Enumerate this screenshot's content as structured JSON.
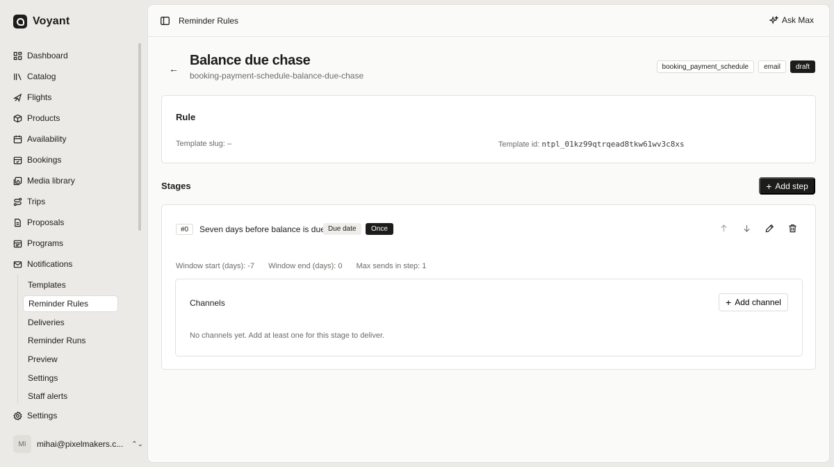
{
  "app": {
    "name": "Voyant"
  },
  "sidebar": {
    "items": [
      {
        "label": "Dashboard",
        "icon": "dashboard-icon"
      },
      {
        "label": "Catalog",
        "icon": "library-icon"
      },
      {
        "label": "Flights",
        "icon": "plane-icon"
      },
      {
        "label": "Products",
        "icon": "box-icon"
      },
      {
        "label": "Availability",
        "icon": "calendar-icon"
      },
      {
        "label": "Bookings",
        "icon": "calendar-check-icon"
      },
      {
        "label": "Media library",
        "icon": "image-icon"
      },
      {
        "label": "Trips",
        "icon": "route-icon"
      },
      {
        "label": "Proposals",
        "icon": "file-icon"
      },
      {
        "label": "Programs",
        "icon": "calendar-range-icon"
      },
      {
        "label": "Notifications",
        "icon": "mail-icon"
      }
    ],
    "sub_items": [
      {
        "label": "Templates"
      },
      {
        "label": "Reminder Rules",
        "active": true
      },
      {
        "label": "Deliveries"
      },
      {
        "label": "Reminder Runs"
      },
      {
        "label": "Preview"
      },
      {
        "label": "Settings"
      },
      {
        "label": "Staff alerts"
      }
    ],
    "settings_label": "Settings",
    "user": {
      "initials": "MI",
      "email": "mihai@pixelmakers.c..."
    }
  },
  "topbar": {
    "breadcrumb": "Reminder Rules",
    "ask_label": "Ask Max"
  },
  "page": {
    "title": "Balance due chase",
    "slug": "booking-payment-schedule-balance-due-chase",
    "tags": [
      "booking_payment_schedule",
      "email",
      "draft"
    ]
  },
  "rule": {
    "title": "Rule",
    "template_slug_label": "Template slug: –",
    "template_id_label": "Template id: ",
    "template_id_value": "ntpl_01kz99qtrqead8tkw61wv3c8xs"
  },
  "stages": {
    "title": "Stages",
    "add_step_label": "Add step",
    "items": [
      {
        "number": "#0",
        "name": "Seven days before balance is due",
        "trigger": "Due date",
        "frequency": "Once",
        "window_start": "Window start (days): -7",
        "window_end": "Window end (days): 0",
        "max_sends": "Max sends in step: 1",
        "channels_title": "Channels",
        "add_channel_label": "Add channel",
        "channels_empty": "No channels yet. Add at least one for this stage to deliver."
      }
    ]
  }
}
